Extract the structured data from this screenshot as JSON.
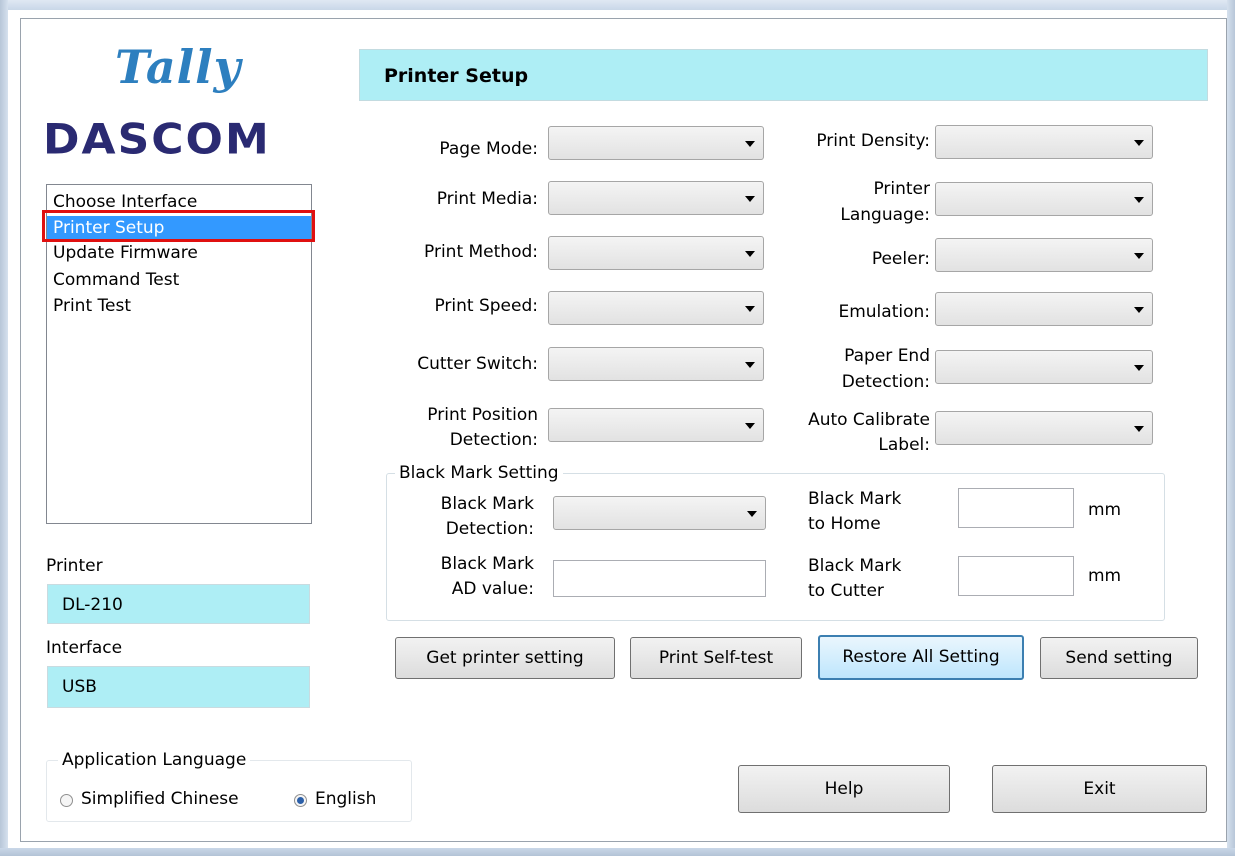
{
  "logo": {
    "brand_top": "Tally",
    "brand_bottom": "DASCOM"
  },
  "nav": {
    "items": [
      "Choose Interface",
      "Printer Setup",
      "Update Firmware",
      "Command Test",
      "Print Test"
    ],
    "selected": "Printer Setup"
  },
  "printer": {
    "label": "Printer",
    "value": "DL-210"
  },
  "interface": {
    "label": "Interface",
    "value": "USB"
  },
  "app_language": {
    "title": "Application Language",
    "options": [
      "Simplified Chinese",
      "English"
    ],
    "selected": "English"
  },
  "header": {
    "title": "Printer Setup"
  },
  "fields": {
    "page_mode": "Page Mode:",
    "print_media": "Print Media:",
    "print_method": "Print Method:",
    "print_speed": "Print Speed:",
    "cutter_switch": "Cutter Switch:",
    "print_position_1": "Print Position",
    "print_position_2": "Detection:",
    "print_density": "Print Density:",
    "printer_language_1": "Printer",
    "printer_language_2": "Language:",
    "peeler": "Peeler:",
    "emulation": "Emulation:",
    "paper_end_1": "Paper End",
    "paper_end_2": "Detection:",
    "auto_calibrate_1": "Auto Calibrate",
    "auto_calibrate_2": "Label:"
  },
  "black_mark": {
    "title": "Black Mark Setting",
    "detection_1": "Black Mark",
    "detection_2": "Detection:",
    "ad_1": "Black Mark",
    "ad_2": "AD value:",
    "home_1": "Black Mark",
    "home_2": "to Home",
    "cutter_1": "Black Mark",
    "cutter_2": "to Cutter",
    "unit_home": "mm",
    "unit_cutter": "mm"
  },
  "buttons": {
    "get_setting": "Get printer setting",
    "self_test": "Print Self-test",
    "restore": "Restore All Setting",
    "send": "Send setting",
    "help": "Help",
    "exit": "Exit"
  }
}
